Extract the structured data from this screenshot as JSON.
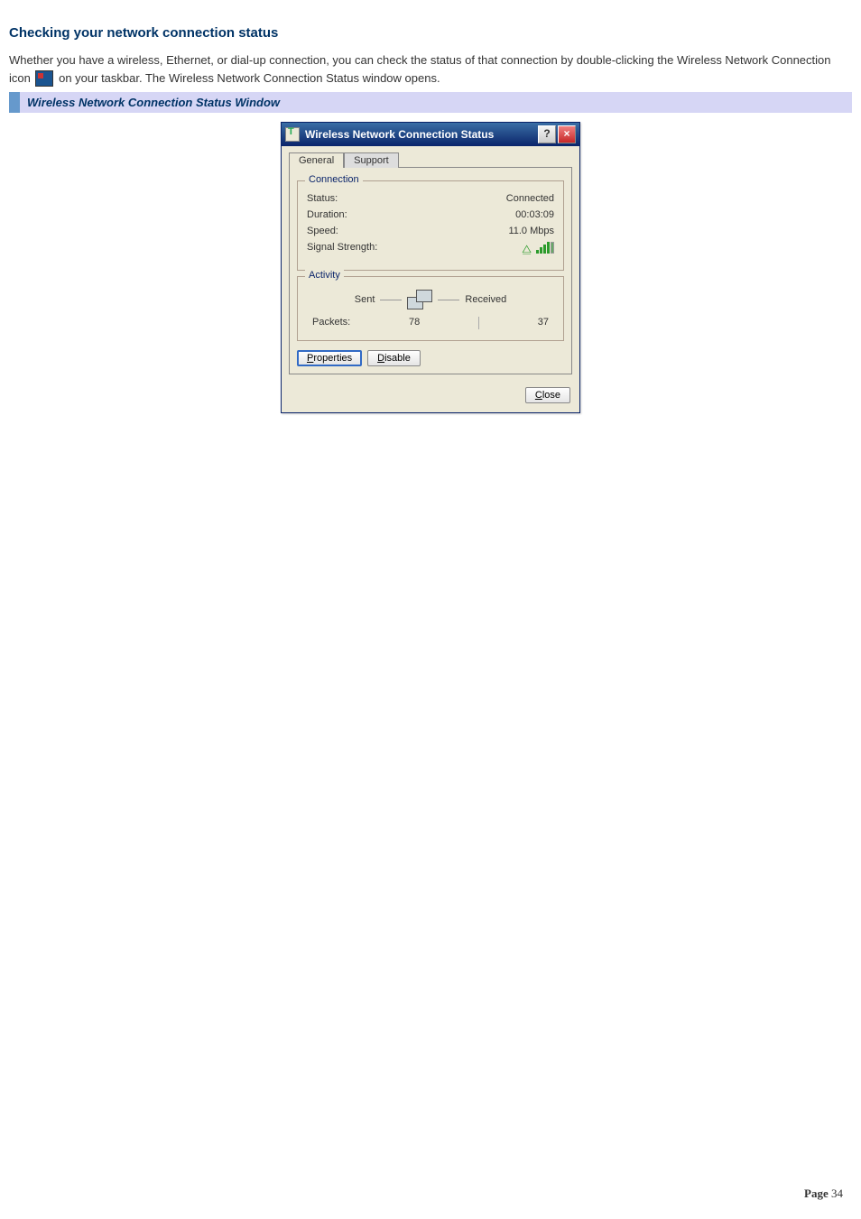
{
  "page": {
    "heading": "Checking your network connection status",
    "para1_a": "Whether you have a wireless, Ethernet, or dial-up connection, you can check the status of that connection by double-clicking the Wireless Network Connection icon ",
    "para1_b": " on your taskbar. The Wireless Network Connection Status window opens.",
    "banner": "Wireless Network Connection Status Window",
    "footer_label": "Page ",
    "footer_num": "34"
  },
  "dialog": {
    "title": "Wireless Network Connection Status",
    "tabs": {
      "general": "General",
      "support": "Support"
    },
    "connection": {
      "legend": "Connection",
      "status_label": "Status:",
      "status_value": "Connected",
      "duration_label": "Duration:",
      "duration_value": "00:03:09",
      "speed_label": "Speed:",
      "speed_value": "11.0 Mbps",
      "signal_label": "Signal Strength:"
    },
    "activity": {
      "legend": "Activity",
      "sent": "Sent",
      "received": "Received",
      "packets_label": "Packets:",
      "sent_value": "78",
      "received_value": "37"
    },
    "buttons": {
      "properties": "Properties",
      "disable": "Disable",
      "close": "Close"
    }
  }
}
